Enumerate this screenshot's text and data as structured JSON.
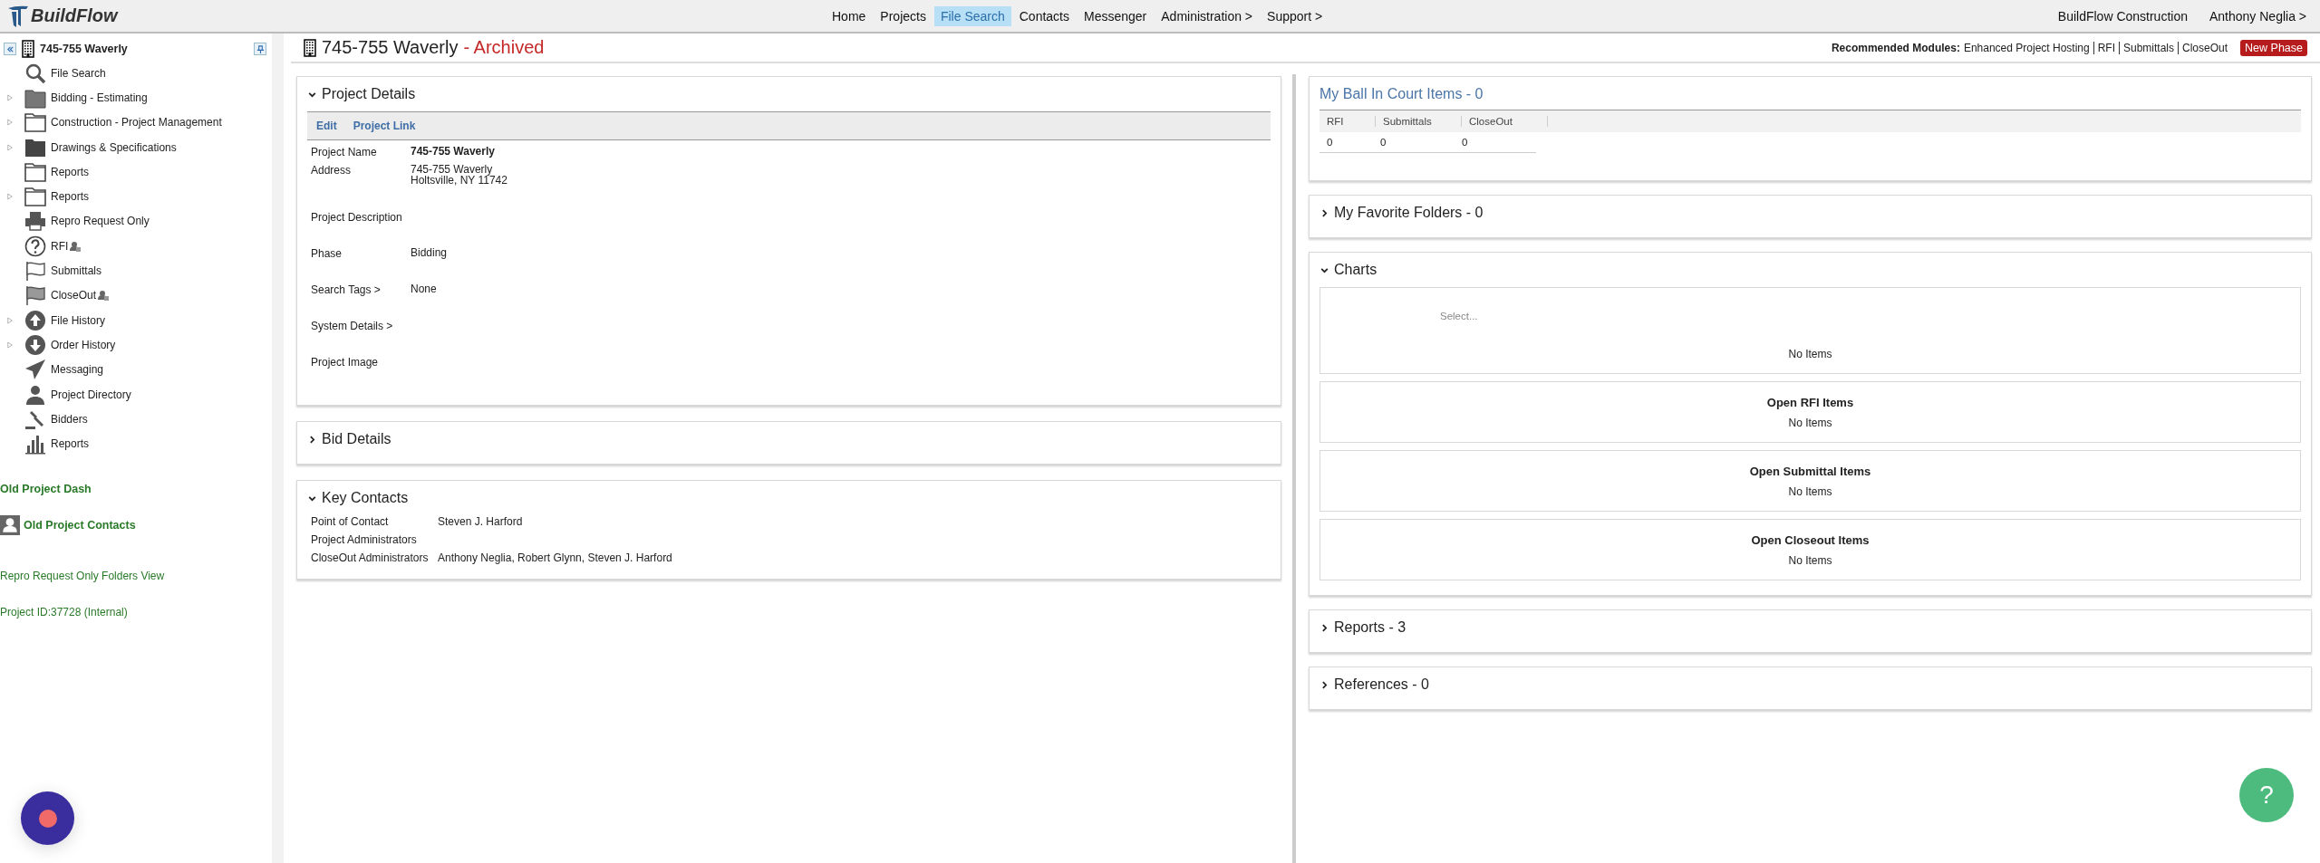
{
  "brand": {
    "name": "BuildFlow"
  },
  "nav": [
    {
      "label": "Home",
      "selected": false
    },
    {
      "label": "Projects",
      "selected": false
    },
    {
      "label": "File Search",
      "selected": true
    },
    {
      "label": "Contacts",
      "selected": false
    },
    {
      "label": "Messenger",
      "selected": false
    },
    {
      "label": "Administration >",
      "selected": false
    },
    {
      "label": "Support >",
      "selected": false
    }
  ],
  "account": [
    "BuildFlow Construction",
    "Anthony Neglia >"
  ],
  "sidebar": {
    "tree": {
      "label": "745-755 Waverly",
      "children": [
        {
          "label": "File Search",
          "kind": "search",
          "expandable": false,
          "user_badge": false
        },
        {
          "label": "Bidding - Estimating",
          "kind": "binder",
          "expandable": true,
          "user_badge": false
        },
        {
          "label": "Construction - Project Management",
          "kind": "folder",
          "expandable": true,
          "user_badge": false
        },
        {
          "label": "Drawings & Specifications",
          "kind": "darkfolder",
          "expandable": true,
          "user_badge": false
        },
        {
          "label": "Reports",
          "kind": "folder",
          "expandable": false,
          "user_badge": false
        },
        {
          "label": "Reports",
          "kind": "folder",
          "expandable": true,
          "user_badge": false
        },
        {
          "label": "Repro Request Only",
          "kind": "printer",
          "expandable": false,
          "user_badge": false
        },
        {
          "label": "RFI",
          "kind": "question",
          "expandable": false,
          "user_badge": true
        },
        {
          "label": "Submittals",
          "kind": "flag",
          "expandable": false,
          "user_badge": false
        },
        {
          "label": "CloseOut",
          "kind": "checkered",
          "expandable": false,
          "user_badge": true
        },
        {
          "label": "File History",
          "kind": "upload",
          "expandable": true,
          "user_badge": false
        },
        {
          "label": "Order History",
          "kind": "download",
          "expandable": true,
          "user_badge": false
        },
        {
          "label": "Messaging",
          "kind": "plane",
          "expandable": false,
          "user_badge": false
        },
        {
          "label": "Project Directory",
          "kind": "person",
          "expandable": false,
          "user_badge": false
        },
        {
          "label": "Bidders",
          "kind": "gavel",
          "expandable": false,
          "user_badge": false
        },
        {
          "label": "Reports",
          "kind": "chart",
          "expandable": false,
          "user_badge": false
        }
      ]
    },
    "links": [
      {
        "label": "Old Project Dash",
        "kind": "bold"
      },
      {
        "label": "Old Project Contacts",
        "kind": "contact"
      },
      {
        "label": "Repro Request Only Folders View",
        "kind": "plain"
      },
      {
        "label": "Project ID:37728 (Internal)",
        "kind": "plain"
      }
    ]
  },
  "header": {
    "title": "745-755 Waverly",
    "status": "- Archived",
    "modules_label": "Recommended Modules:",
    "modules": [
      "Enhanced Project Hosting",
      "RFI",
      "Submittals",
      "CloseOut"
    ],
    "new_phase": "New Phase"
  },
  "project_details": {
    "title": "Project Details",
    "expanded": true,
    "actions": [
      "Edit",
      "Project Link"
    ],
    "fields": [
      {
        "label": "Project Name",
        "value": "745-755 Waverly",
        "kind": "bold"
      },
      {
        "label": "Address",
        "value": "745-755 Waverly\nHoltsville, NY 11742",
        "kind": "plain"
      },
      {
        "label": "Project Description"
      },
      {
        "label": "Phase",
        "value": "Bidding",
        "kind": "plain"
      },
      {
        "label": "Search Tags >",
        "value": "None",
        "kind": "plain"
      },
      {
        "label": "System Details >"
      },
      {
        "label": "Project Image"
      }
    ]
  },
  "bid_details": {
    "title": "Bid Details",
    "expanded": false
  },
  "key_contacts": {
    "title": "Key Contacts",
    "expanded": true,
    "rows": [
      {
        "label": "Point of Contact",
        "value": "Steven J. Harford"
      },
      {
        "label": "Project Administrators"
      },
      {
        "label": "CloseOut Administrators",
        "value": "Anthony Neglia, Robert Glynn, Steven J. Harford"
      }
    ]
  },
  "ball_in_court": {
    "title": "My Ball In Court Items - 0",
    "columns": [
      "RFI",
      "Submittals",
      "CloseOut"
    ],
    "values": [
      "0",
      "0",
      "0"
    ]
  },
  "favorite_folders": {
    "title": "My Favorite Folders - 0",
    "expanded": false
  },
  "charts": {
    "title": "Charts",
    "expanded": true,
    "select": {
      "placeholder": "Select..."
    },
    "chart_empty": "No Items",
    "groups": [
      {
        "title": "Open RFI Items",
        "empty": "No Items"
      },
      {
        "title": "Open Submittal Items",
        "empty": "No Items"
      },
      {
        "title": "Open Closeout Items",
        "empty": "No Items"
      }
    ]
  },
  "reports": {
    "title": "Reports - 3",
    "expanded": false
  },
  "references": {
    "title": "References - 0",
    "expanded": false
  },
  "help_button": {
    "label": "?"
  }
}
